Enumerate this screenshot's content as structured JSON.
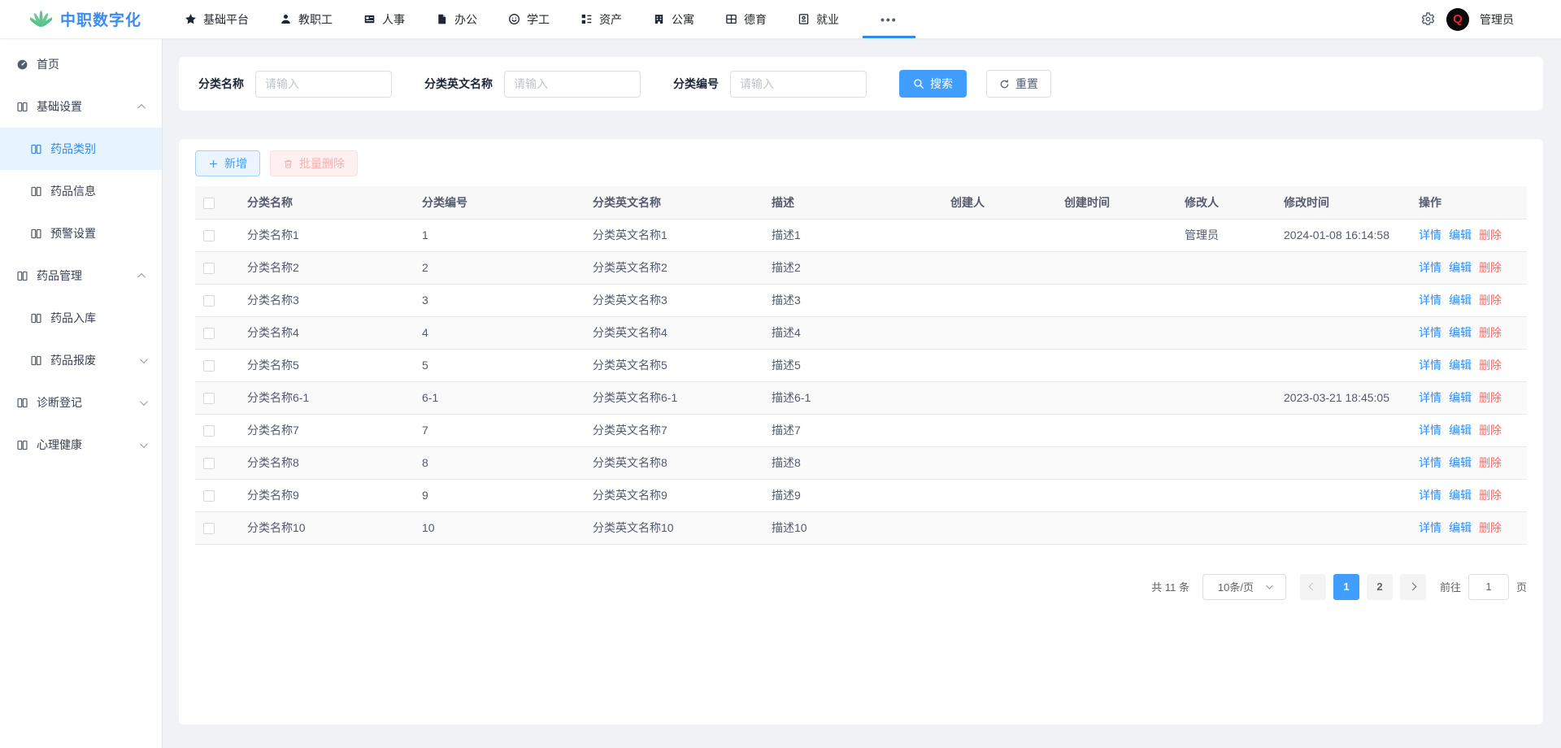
{
  "brand": {
    "title": "中职数字化"
  },
  "header": {
    "nav_items": [
      {
        "label": "基础平台",
        "icon": "star-icon"
      },
      {
        "label": "教职工",
        "icon": "person-icon"
      },
      {
        "label": "人事",
        "icon": "idcard-icon"
      },
      {
        "label": "办公",
        "icon": "office-doc-icon"
      },
      {
        "label": "学工",
        "icon": "student-icon"
      },
      {
        "label": "资产",
        "icon": "asset-tree-icon"
      },
      {
        "label": "公寓",
        "icon": "apartment-icon"
      },
      {
        "label": "德育",
        "icon": "grid-icon"
      },
      {
        "label": "就业",
        "icon": "employment-doc-icon"
      }
    ],
    "more_label": "•••",
    "admin_name": "管理员",
    "avatar_letter": "Q"
  },
  "sidebar": {
    "items": [
      {
        "label": "首页",
        "type": "top",
        "icon": "dashboard-icon",
        "state": "none",
        "active": false
      },
      {
        "label": "基础设置",
        "type": "top",
        "icon": "book-icon",
        "state": "expanded",
        "active": false
      },
      {
        "label": "药品类别",
        "type": "sub",
        "icon": "book-icon",
        "state": "none",
        "active": true
      },
      {
        "label": "药品信息",
        "type": "sub",
        "icon": "book-icon",
        "state": "none",
        "active": false
      },
      {
        "label": "预警设置",
        "type": "sub",
        "icon": "book-icon",
        "state": "none",
        "active": false
      },
      {
        "label": "药品管理",
        "type": "top",
        "icon": "book-icon",
        "state": "expanded",
        "active": false
      },
      {
        "label": "药品入库",
        "type": "sub",
        "icon": "book-icon",
        "state": "none",
        "active": false
      },
      {
        "label": "药品报废",
        "type": "sub",
        "icon": "book-icon",
        "state": "collapsed",
        "active": false
      },
      {
        "label": "诊断登记",
        "type": "top",
        "icon": "book-icon",
        "state": "collapsed",
        "active": false
      },
      {
        "label": "心理健康",
        "type": "top",
        "icon": "book-icon",
        "state": "collapsed",
        "active": false
      }
    ]
  },
  "search": {
    "fields": [
      {
        "label": "分类名称",
        "placeholder": "请输入",
        "value": ""
      },
      {
        "label": "分类英文名称",
        "placeholder": "请输入",
        "value": ""
      },
      {
        "label": "分类编号",
        "placeholder": "请输入",
        "value": ""
      }
    ],
    "search_label": "搜索",
    "reset_label": "重置"
  },
  "toolbar": {
    "add_label": "新增",
    "batch_delete_label": "批量删除"
  },
  "table": {
    "columns": [
      "分类名称",
      "分类编号",
      "分类英文名称",
      "描述",
      "创建人",
      "创建时间",
      "修改人",
      "修改时间",
      "操作"
    ],
    "ops": {
      "detail": "详情",
      "edit": "编辑",
      "delete": "删除"
    },
    "rows": [
      {
        "name": "分类名称1",
        "code": "1",
        "en_name": "分类英文名称1",
        "desc": "描述1",
        "creator": "",
        "create_time": "",
        "modifier": "管理员",
        "modify_time": "2024-01-08 16:14:58"
      },
      {
        "name": "分类名称2",
        "code": "2",
        "en_name": "分类英文名称2",
        "desc": "描述2",
        "creator": "",
        "create_time": "",
        "modifier": "",
        "modify_time": ""
      },
      {
        "name": "分类名称3",
        "code": "3",
        "en_name": "分类英文名称3",
        "desc": "描述3",
        "creator": "",
        "create_time": "",
        "modifier": "",
        "modify_time": ""
      },
      {
        "name": "分类名称4",
        "code": "4",
        "en_name": "分类英文名称4",
        "desc": "描述4",
        "creator": "",
        "create_time": "",
        "modifier": "",
        "modify_time": ""
      },
      {
        "name": "分类名称5",
        "code": "5",
        "en_name": "分类英文名称5",
        "desc": "描述5",
        "creator": "",
        "create_time": "",
        "modifier": "",
        "modify_time": ""
      },
      {
        "name": "分类名称6-1",
        "code": "6-1",
        "en_name": "分类英文名称6-1",
        "desc": "描述6-1",
        "creator": "",
        "create_time": "",
        "modifier": "",
        "modify_time": "2023-03-21 18:45:05"
      },
      {
        "name": "分类名称7",
        "code": "7",
        "en_name": "分类英文名称7",
        "desc": "描述7",
        "creator": "",
        "create_time": "",
        "modifier": "",
        "modify_time": ""
      },
      {
        "name": "分类名称8",
        "code": "8",
        "en_name": "分类英文名称8",
        "desc": "描述8",
        "creator": "",
        "create_time": "",
        "modifier": "",
        "modify_time": ""
      },
      {
        "name": "分类名称9",
        "code": "9",
        "en_name": "分类英文名称9",
        "desc": "描述9",
        "creator": "",
        "create_time": "",
        "modifier": "",
        "modify_time": ""
      },
      {
        "name": "分类名称10",
        "code": "10",
        "en_name": "分类英文名称10",
        "desc": "描述10",
        "creator": "",
        "create_time": "",
        "modifier": "",
        "modify_time": ""
      }
    ]
  },
  "pagination": {
    "total_text": "共 11 条",
    "page_size_label": "10条/页",
    "pages": [
      "1",
      "2"
    ],
    "active_page": "1",
    "goto_label": "前往",
    "goto_value": "1",
    "unit_label": "页"
  },
  "colors": {
    "primary_blue": "#2d8cf0",
    "button_blue": "#409eff",
    "danger_red": "#f56c6c",
    "brand_green": "#57c28b",
    "sidebar_active_bg": "#e7f3fd",
    "table_header_bg": "#f8f8f9",
    "page_bg": "#f0f2f5"
  }
}
